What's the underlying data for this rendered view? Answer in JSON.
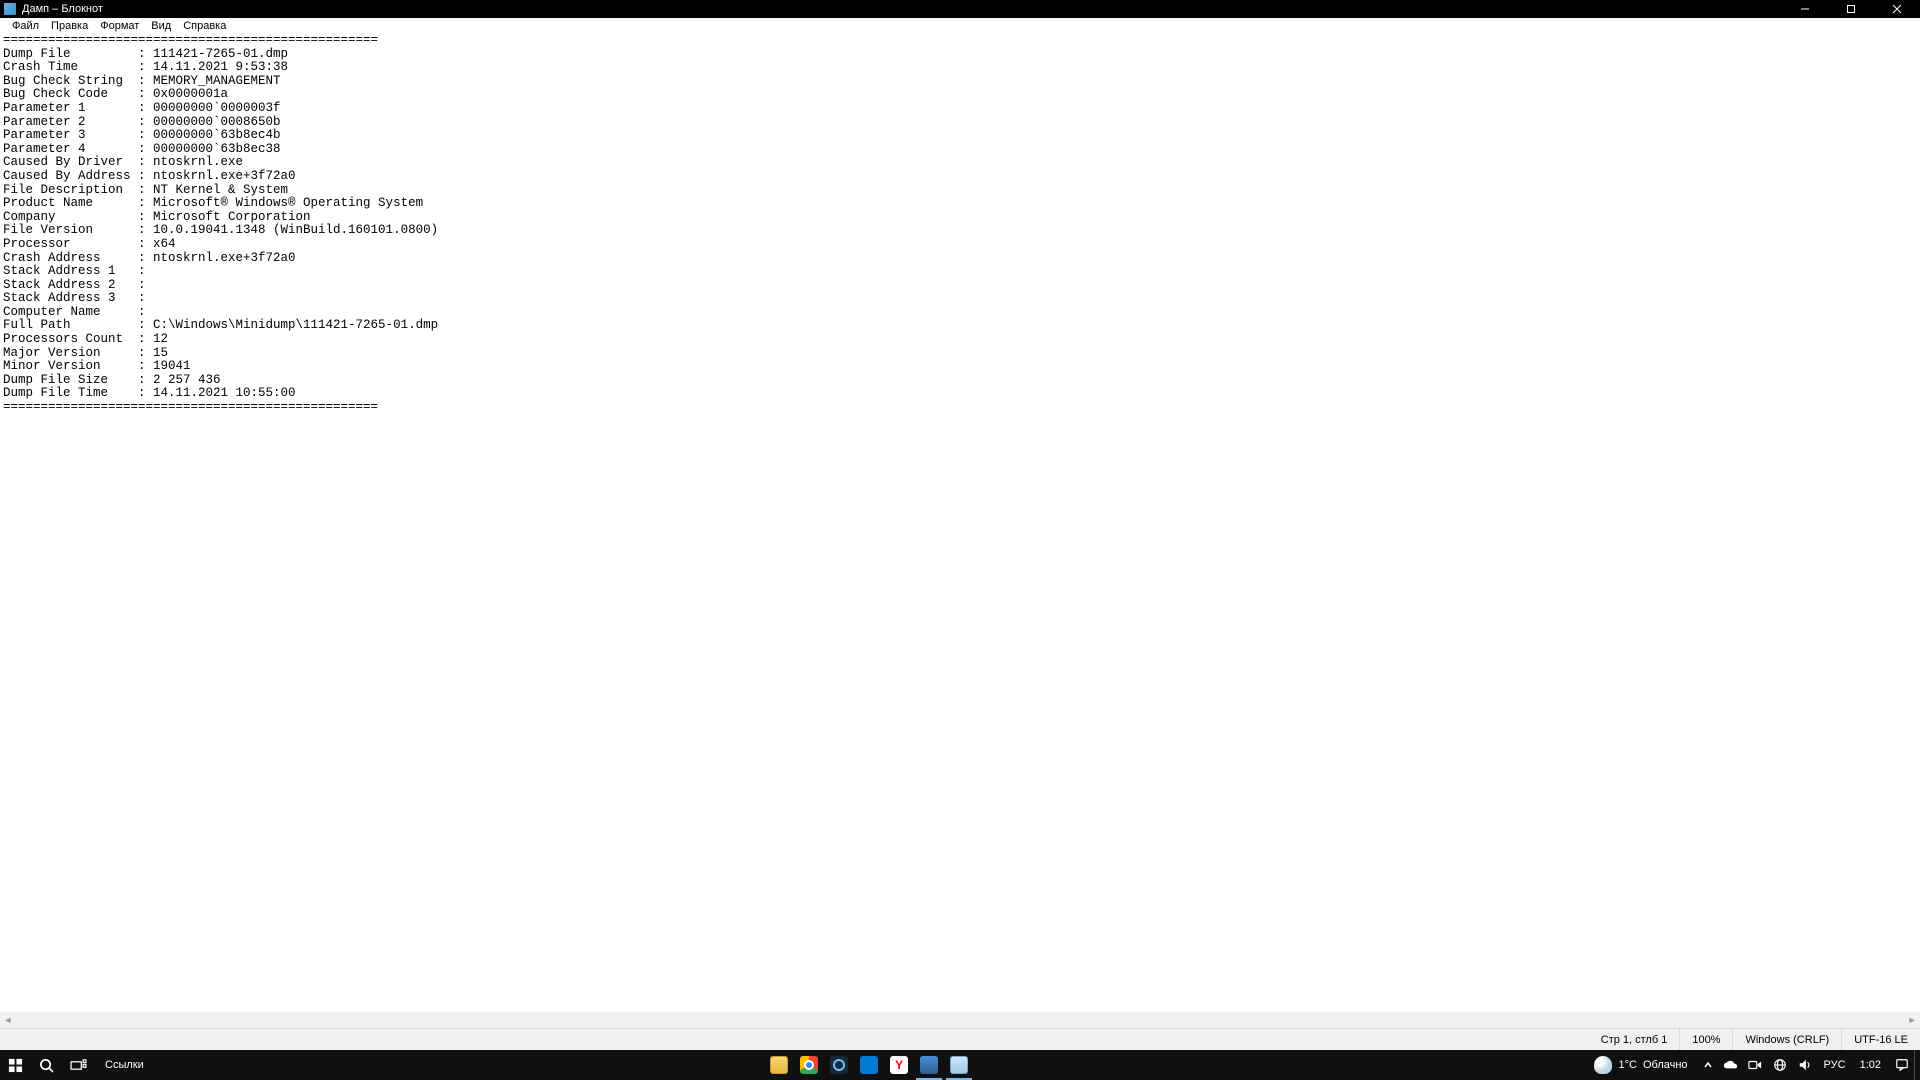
{
  "titlebar": {
    "title": "Дамп – Блокнот"
  },
  "menu": {
    "file": "Файл",
    "edit": "Правка",
    "format": "Формат",
    "view": "Вид",
    "help": "Справка"
  },
  "dump": {
    "separator": "==================================================",
    "fields": [
      {
        "label": "Dump File         ",
        "value": "111421-7265-01.dmp"
      },
      {
        "label": "Crash Time        ",
        "value": "14.11.2021 9:53:38"
      },
      {
        "label": "Bug Check String  ",
        "value": "MEMORY_MANAGEMENT"
      },
      {
        "label": "Bug Check Code    ",
        "value": "0x0000001a"
      },
      {
        "label": "Parameter 1       ",
        "value": "00000000`0000003f"
      },
      {
        "label": "Parameter 2       ",
        "value": "00000000`0008650b"
      },
      {
        "label": "Parameter 3       ",
        "value": "00000000`63b8ec4b"
      },
      {
        "label": "Parameter 4       ",
        "value": "00000000`63b8ec38"
      },
      {
        "label": "Caused By Driver  ",
        "value": "ntoskrnl.exe"
      },
      {
        "label": "Caused By Address ",
        "value": "ntoskrnl.exe+3f72a0"
      },
      {
        "label": "File Description  ",
        "value": "NT Kernel & System"
      },
      {
        "label": "Product Name      ",
        "value": "Microsoft® Windows® Operating System"
      },
      {
        "label": "Company           ",
        "value": "Microsoft Corporation"
      },
      {
        "label": "File Version      ",
        "value": "10.0.19041.1348 (WinBuild.160101.0800)"
      },
      {
        "label": "Processor         ",
        "value": "x64"
      },
      {
        "label": "Crash Address     ",
        "value": "ntoskrnl.exe+3f72a0"
      },
      {
        "label": "Stack Address 1   ",
        "value": ""
      },
      {
        "label": "Stack Address 2   ",
        "value": ""
      },
      {
        "label": "Stack Address 3   ",
        "value": ""
      },
      {
        "label": "Computer Name     ",
        "value": ""
      },
      {
        "label": "Full Path         ",
        "value": "C:\\Windows\\Minidump\\111421-7265-01.dmp"
      },
      {
        "label": "Processors Count  ",
        "value": "12"
      },
      {
        "label": "Major Version     ",
        "value": "15"
      },
      {
        "label": "Minor Version     ",
        "value": "19041"
      },
      {
        "label": "Dump File Size    ",
        "value": "2 257 436"
      },
      {
        "label": "Dump File Time    ",
        "value": "14.11.2021 10:55:00"
      }
    ]
  },
  "statusbar": {
    "position": "Стр 1, стлб 1",
    "zoom": "100%",
    "lineending": "Windows (CRLF)",
    "encoding": "UTF-16 LE"
  },
  "taskbar": {
    "links": "Ссылки",
    "weather_temp": "1°C",
    "weather_cond": "Облачно",
    "lang": "РУС",
    "time": "1:02"
  }
}
